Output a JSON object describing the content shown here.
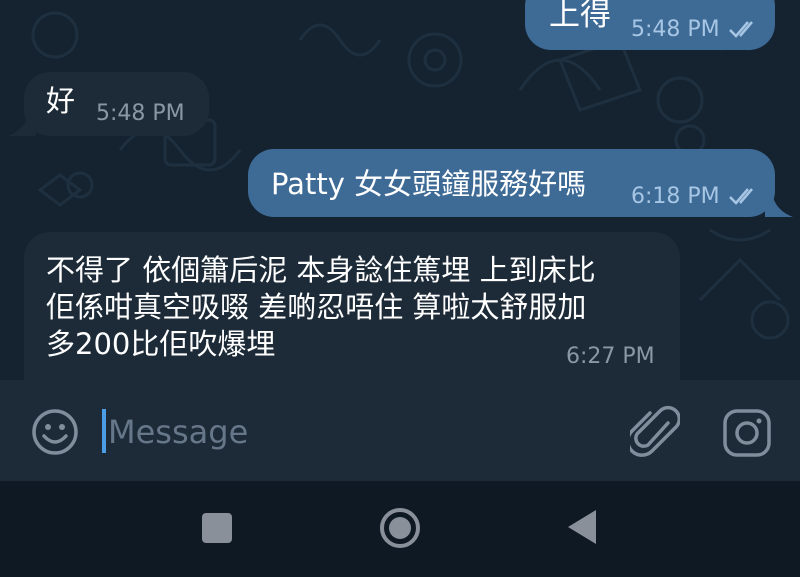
{
  "messages": [
    {
      "direction": "outgoing",
      "text": "上得",
      "time": "5:48 PM",
      "status": "read"
    },
    {
      "direction": "incoming",
      "text": "好",
      "time": "5:48 PM"
    },
    {
      "direction": "outgoing",
      "text": "Patty 女女頭鐘服務好嗎",
      "time": "6:18 PM",
      "status": "read"
    },
    {
      "direction": "incoming",
      "lines": [
        "不得了 依個簫后泥 本身諗住篤埋 上到床比",
        "佢係咁真空吸啜 差啲忍唔住 算啦太舒服加",
        "多200比佢吹爆埋"
      ],
      "time": "6:27 PM"
    }
  ],
  "composer": {
    "placeholder": "Message"
  },
  "icons": {
    "emoji": "smiley-face-icon",
    "attach": "paperclip-icon",
    "camera": "instagram-camera-icon",
    "ticks": "double-check-icon",
    "nav_recent": "square-icon",
    "nav_home": "circle-icon",
    "nav_back": "triangle-back-icon"
  },
  "colors": {
    "outgoing_bubble": "#3e6a96",
    "incoming_bubble": "#1d2b38",
    "chat_background": "#152330",
    "caret": "#4d9de6"
  }
}
